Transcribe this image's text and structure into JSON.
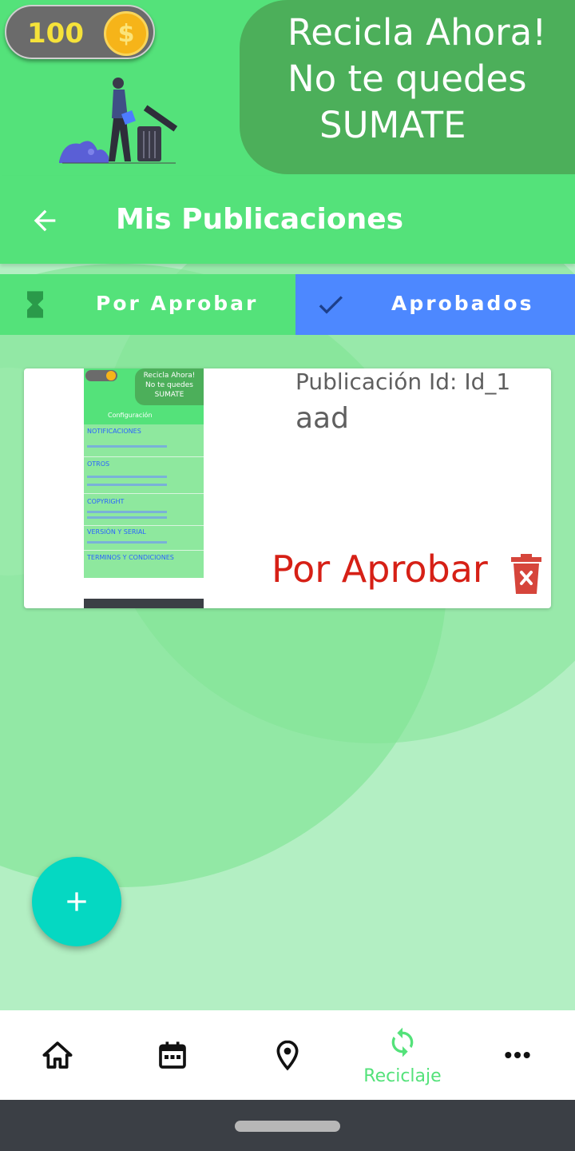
{
  "header": {
    "coins": "100",
    "coin_symbol": "$",
    "slogan": [
      "Recicla Ahora!",
      "No te quedes",
      "SUMATE"
    ]
  },
  "app_bar": {
    "title": "Mis Publicaciones"
  },
  "tabs": [
    {
      "label": "Por Aprobar",
      "icon": "hourglass-icon",
      "selected": false
    },
    {
      "label": "Aprobados",
      "icon": "check-icon",
      "selected": true
    }
  ],
  "publication": {
    "id_text": "Publicación Id: Id_1",
    "description": "aad",
    "status": "Por Aprobar",
    "thumbnail": {
      "coins": "0",
      "slogan": "Recicla Ahora!\nNo te quedes\nSUMATE",
      "title": "Configuración",
      "sections": [
        "NOTIFICACIONES",
        "OTROS",
        "COPYRIGHT",
        "VERSIÓN Y SERIAL",
        "TERMINOS Y CONDICIONES"
      ]
    }
  },
  "bottom_nav": [
    {
      "icon": "home-icon",
      "label": "",
      "active": false
    },
    {
      "icon": "calendar-icon",
      "label": "",
      "active": false
    },
    {
      "icon": "location-pin-icon",
      "label": "",
      "active": false
    },
    {
      "icon": "recycle-icon",
      "label": "Reciclaje",
      "active": true
    },
    {
      "icon": "more-icon",
      "label": "",
      "active": false
    }
  ],
  "colors": {
    "header_green": "#54e27a",
    "slogan_green": "#4caf5a",
    "selected_tab_blue": "#4d88ff",
    "status_red": "#d62016",
    "fab_teal": "#05d8c2"
  }
}
